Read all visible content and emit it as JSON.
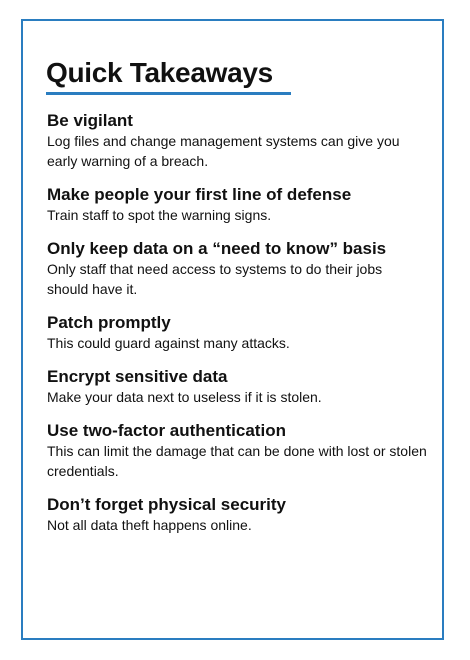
{
  "title": "Quick Takeaways",
  "accent_color": "#2a7dc0",
  "items": [
    {
      "heading": "Be vigilant",
      "body": "Log files and change management systems can give you early warning of a breach."
    },
    {
      "heading": "Make people your first line of defense",
      "body": "Train staff to spot the warning signs."
    },
    {
      "heading": "Only keep data on a “need to know” basis",
      "body": "Only staff that need access to systems to do their jobs should have it."
    },
    {
      "heading": "Patch promptly",
      "body": "This could guard against many attacks."
    },
    {
      "heading": "Encrypt sensitive data",
      "body": "Make your data next to useless if it is stolen."
    },
    {
      "heading": "Use two-factor authentication",
      "body": "This can limit the damage that can be done with lost or stolen credentials."
    },
    {
      "heading": "Don’t forget physical security",
      "body": "Not all data theft happens online."
    }
  ]
}
